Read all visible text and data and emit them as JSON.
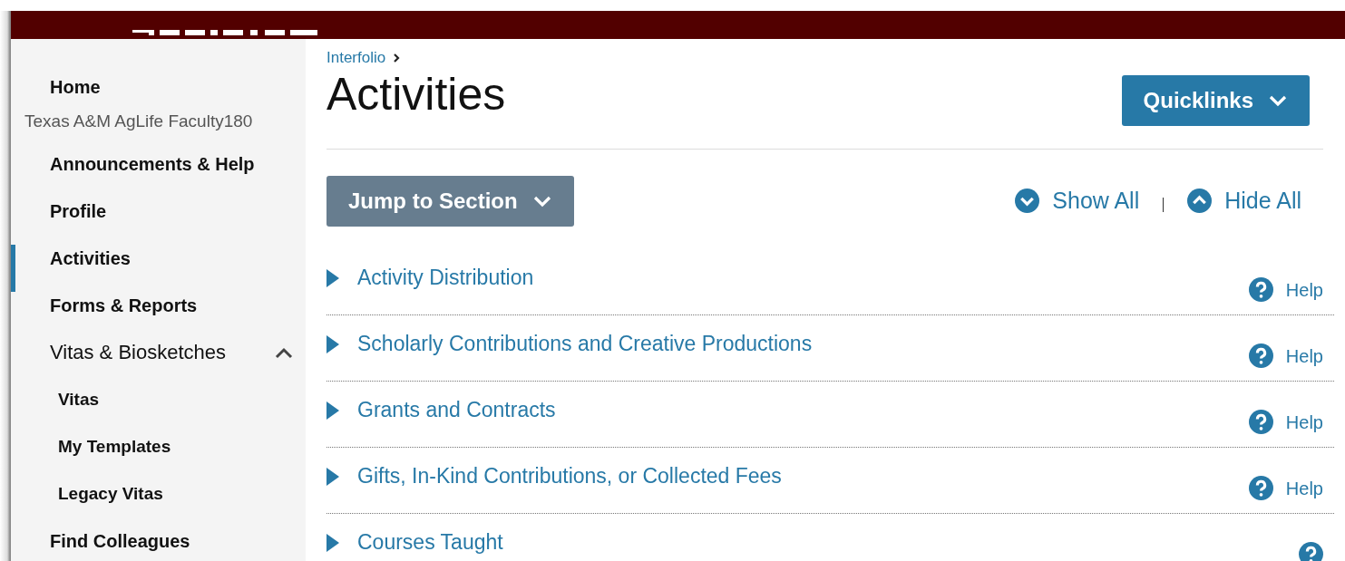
{
  "breadcrumb": {
    "label": "Interfolio"
  },
  "page_title": "Activities",
  "quicklinks_button": {
    "label": "Quicklinks"
  },
  "jump_button": {
    "label": "Jump to Section"
  },
  "show_all": {
    "label": "Show All"
  },
  "hide_all": {
    "label": "Hide All"
  },
  "sidebar": {
    "items": [
      {
        "kind": "link",
        "label": "Home",
        "selected": false
      },
      {
        "kind": "heading",
        "label": "Texas A&M AgLife Faculty180"
      },
      {
        "kind": "link",
        "label": "Announcements & Help",
        "selected": false
      },
      {
        "kind": "link",
        "label": "Profile",
        "selected": false
      },
      {
        "kind": "link",
        "label": "Activities",
        "selected": true
      },
      {
        "kind": "link",
        "label": "Forms & Reports",
        "selected": false
      },
      {
        "kind": "group",
        "label": "Vitas & Biosketches",
        "expanded": true,
        "children": [
          {
            "label": "Vitas",
            "selected": false
          },
          {
            "label": "My Templates",
            "selected": false
          },
          {
            "label": "Legacy Vitas",
            "selected": false
          }
        ]
      },
      {
        "kind": "link",
        "label": "Find Colleagues",
        "selected": false
      }
    ]
  },
  "sections": [
    {
      "title": "Activity Distribution",
      "expanded": false,
      "help": "Help"
    },
    {
      "title": "Scholarly Contributions and Creative Productions",
      "expanded": false,
      "help": "Help"
    },
    {
      "title": "Grants and Contracts",
      "expanded": false,
      "help": "Help"
    },
    {
      "title": "Gifts, In-Kind Contributions, or Collected Fees",
      "expanded": false,
      "help": "Help"
    },
    {
      "title": "Courses Taught",
      "expanded": false
    }
  ]
}
